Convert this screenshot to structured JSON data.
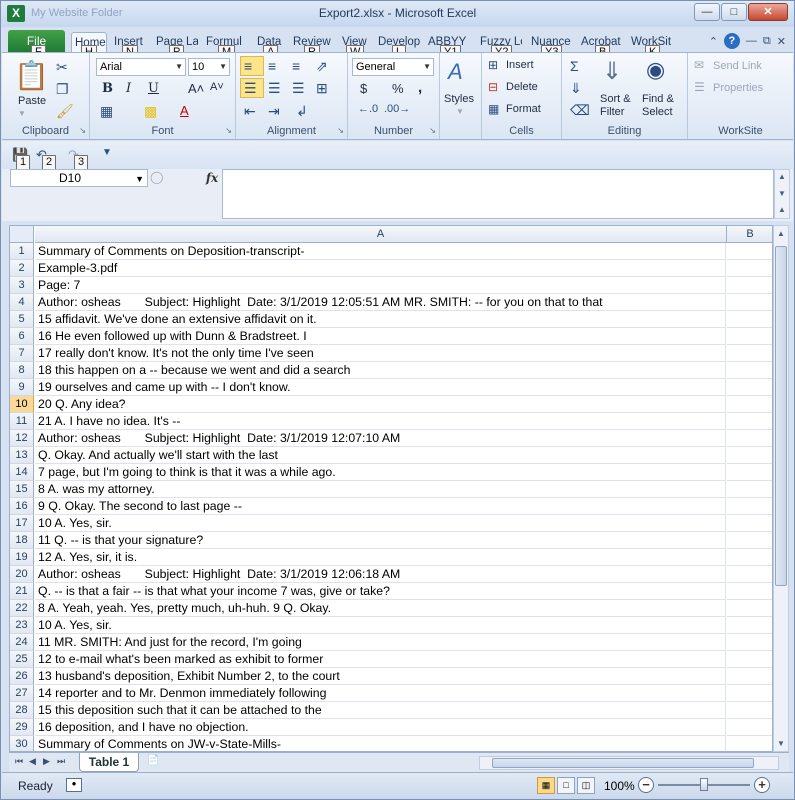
{
  "window": {
    "title": "Export2.xlsx  -  Microsoft Excel",
    "qat_faded": "My Website Folder"
  },
  "tabs": [
    {
      "label": "File",
      "key": "F"
    },
    {
      "label": "Home",
      "key": "H"
    },
    {
      "label": "Insert",
      "key": "N"
    },
    {
      "label": "Page La",
      "key": "P"
    },
    {
      "label": "Formul",
      "key": "M"
    },
    {
      "label": "Data",
      "key": "A"
    },
    {
      "label": "Review",
      "key": "R"
    },
    {
      "label": "View",
      "key": "W"
    },
    {
      "label": "Develop",
      "key": "L"
    },
    {
      "label": "ABBYY F",
      "key": "Y1"
    },
    {
      "label": "Fuzzy Lo",
      "key": "Y2"
    },
    {
      "label": "Nuance",
      "key": "Y3"
    },
    {
      "label": "Acrobat",
      "key": "B"
    },
    {
      "label": "WorkSit",
      "key": "K"
    }
  ],
  "ribbon": {
    "clipboard": {
      "label": "Clipboard",
      "paste": "Paste"
    },
    "font": {
      "label": "Font",
      "name": "Arial",
      "size": "10"
    },
    "alignment": {
      "label": "Alignment"
    },
    "number": {
      "label": "Number",
      "format": "General",
      "currency": "$",
      "percent": "%",
      "comma": ","
    },
    "styles": {
      "label": "Styles"
    },
    "cells": {
      "label": "Cells",
      "insert": "Insert",
      "delete": "Delete",
      "format": "Format"
    },
    "editing": {
      "label": "Editing",
      "sort": "Sort &",
      "filter": "Filter",
      "find": "Find &",
      "select": "Select"
    },
    "worksite": {
      "label": "WorkSite",
      "send_link": "Send Link",
      "properties": "Properties"
    }
  },
  "qat_keys": [
    "1",
    "2",
    "3"
  ],
  "formula_bar": {
    "name_box": "D10",
    "fx": "fx",
    "value": ""
  },
  "grid": {
    "columns": [
      "A",
      "B"
    ],
    "selected_row": 10,
    "rows": [
      {
        "n": 1,
        "a": "Summary of Comments on Deposition-transcript-"
      },
      {
        "n": 2,
        "a": "Example-3.pdf"
      },
      {
        "n": 3,
        "a": "Page: 7"
      },
      {
        "n": 4,
        "a": "Author: osheas       Subject: Highlight  Date: 3/1/2019 12:05:51 AM MR. SMITH: -- for you on that to that"
      },
      {
        "n": 5,
        "a": "15 affidavit. We've done an extensive affidavit on it."
      },
      {
        "n": 6,
        "a": "16 He even followed up with Dunn & Bradstreet. I"
      },
      {
        "n": 7,
        "a": "17 really don't know. It's not the only time I've seen"
      },
      {
        "n": 8,
        "a": "18 this happen on a -- because we went and did a search"
      },
      {
        "n": 9,
        "a": "19 ourselves and came up with -- I don't know."
      },
      {
        "n": 10,
        "a": "20 Q. Any idea?"
      },
      {
        "n": 11,
        "a": "21 A. I have no idea. It's --"
      },
      {
        "n": 12,
        "a": "Author: osheas       Subject: Highlight  Date: 3/1/2019 12:07:10 AM"
      },
      {
        "n": 13,
        "a": "Q. Okay. And actually we'll start with the last"
      },
      {
        "n": 14,
        "a": "7 page, but I'm going to think is that it was a while ago."
      },
      {
        "n": 15,
        "a": "8 A. was my attorney."
      },
      {
        "n": 16,
        "a": "9 Q. Okay. The second to last page --"
      },
      {
        "n": 17,
        "a": "10 A. Yes, sir."
      },
      {
        "n": 18,
        "a": "11 Q. -- is that your signature?"
      },
      {
        "n": 19,
        "a": "12 A. Yes, sir, it is."
      },
      {
        "n": 20,
        "a": "Author: osheas       Subject: Highlight  Date: 3/1/2019 12:06:18 AM"
      },
      {
        "n": 21,
        "a": "Q. -- is that a fair -- is that what your income 7 was, give or take?"
      },
      {
        "n": 22,
        "a": "8 A. Yeah, yeah. Yes, pretty much, uh-huh. 9 Q. Okay."
      },
      {
        "n": 23,
        "a": "10 A. Yes, sir."
      },
      {
        "n": 24,
        "a": "11 MR. SMITH: And just for the record, I'm going"
      },
      {
        "n": 25,
        "a": "12 to e-mail what's been marked as exhibit to former"
      },
      {
        "n": 26,
        "a": "13 husband's deposition, Exhibit Number 2, to the court"
      },
      {
        "n": 27,
        "a": "14 reporter and to Mr. Denmon immediately following"
      },
      {
        "n": 28,
        "a": "15 this deposition such that it can be attached to the"
      },
      {
        "n": 29,
        "a": "16 deposition, and I have no objection."
      },
      {
        "n": 30,
        "a": "Summary of Comments on JW-v-State-Mills-"
      }
    ]
  },
  "sheet_tab": "Table 1",
  "status": {
    "mode": "Ready",
    "zoom": "100%"
  }
}
